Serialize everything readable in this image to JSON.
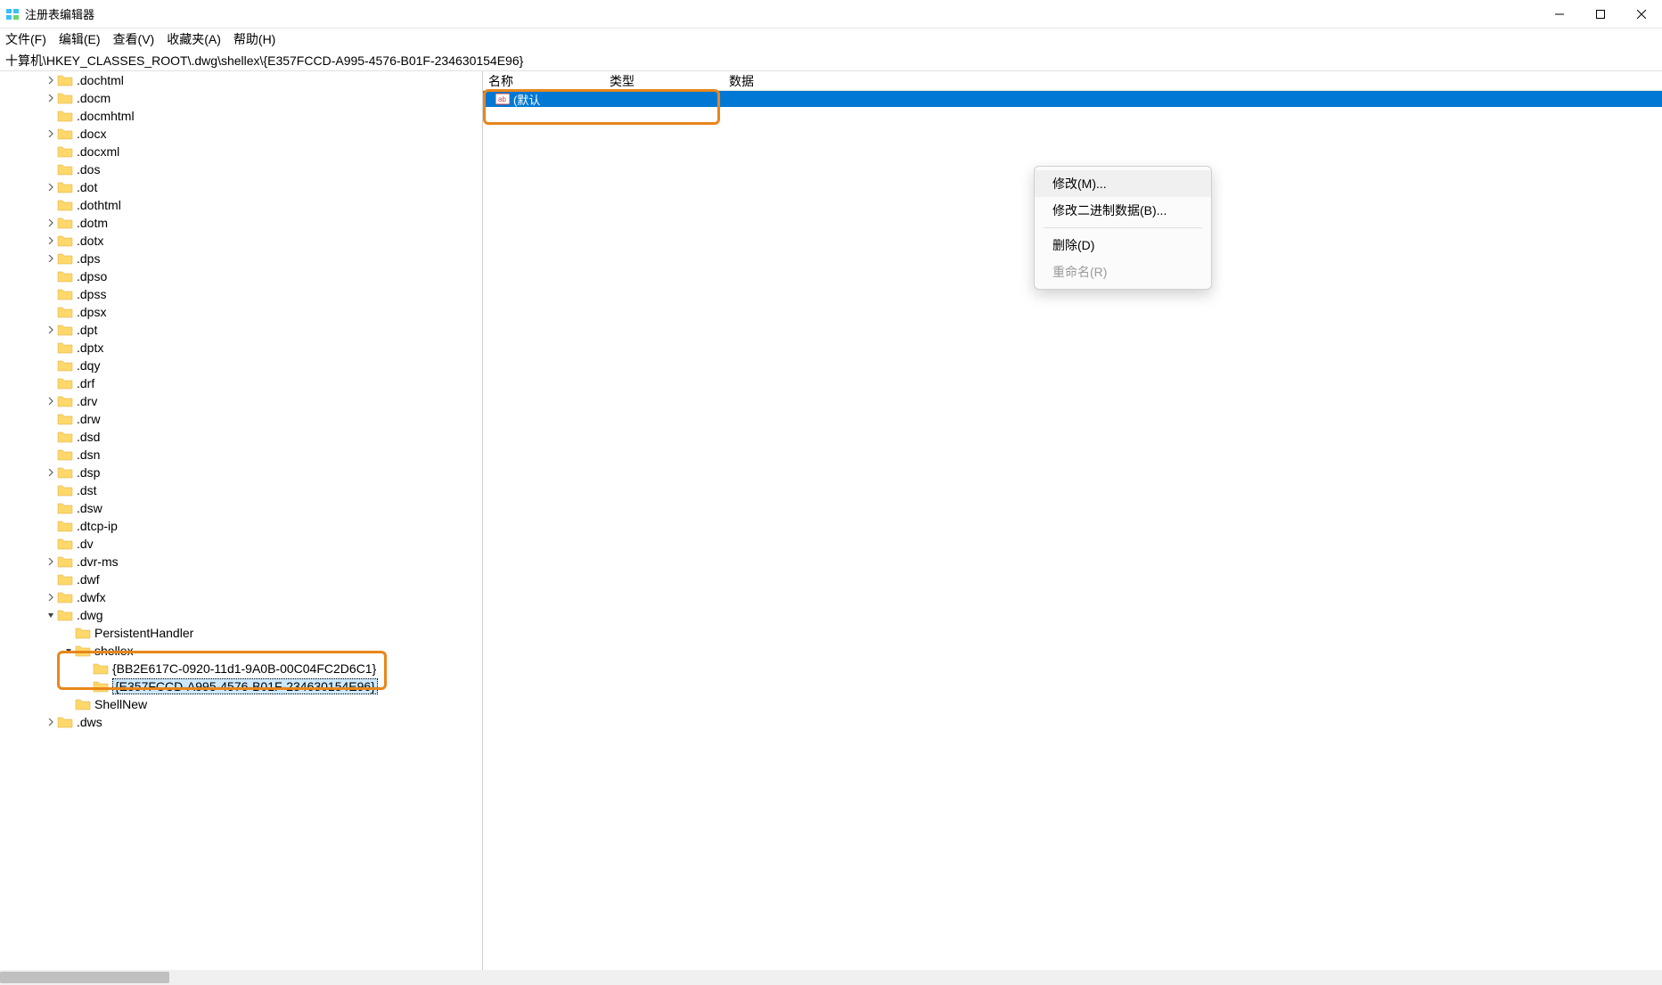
{
  "window": {
    "title": "注册表编辑器"
  },
  "menubar": {
    "file": "文件(F)",
    "edit": "编辑(E)",
    "view": "查看(V)",
    "fav": "收藏夹(A)",
    "help": "帮助(H)"
  },
  "address": "十算机\\HKEY_CLASSES_ROOT\\.dwg\\shellex\\{E357FCCD-A995-4576-B01F-234630154E96}",
  "tree": {
    "items": [
      {
        "label": ".dochtml",
        "indent": 50,
        "expandable": true
      },
      {
        "label": ".docm",
        "indent": 50,
        "expandable": true
      },
      {
        "label": ".docmhtml",
        "indent": 50,
        "expandable": false
      },
      {
        "label": ".docx",
        "indent": 50,
        "expandable": true
      },
      {
        "label": ".docxml",
        "indent": 50,
        "expandable": false
      },
      {
        "label": ".dos",
        "indent": 50,
        "expandable": false
      },
      {
        "label": ".dot",
        "indent": 50,
        "expandable": true
      },
      {
        "label": ".dothtml",
        "indent": 50,
        "expandable": false
      },
      {
        "label": ".dotm",
        "indent": 50,
        "expandable": true
      },
      {
        "label": ".dotx",
        "indent": 50,
        "expandable": true
      },
      {
        "label": ".dps",
        "indent": 50,
        "expandable": true
      },
      {
        "label": ".dpso",
        "indent": 50,
        "expandable": false
      },
      {
        "label": ".dpss",
        "indent": 50,
        "expandable": false
      },
      {
        "label": ".dpsx",
        "indent": 50,
        "expandable": false
      },
      {
        "label": ".dpt",
        "indent": 50,
        "expandable": true
      },
      {
        "label": ".dptx",
        "indent": 50,
        "expandable": false
      },
      {
        "label": ".dqy",
        "indent": 50,
        "expandable": false
      },
      {
        "label": ".drf",
        "indent": 50,
        "expandable": false
      },
      {
        "label": ".drv",
        "indent": 50,
        "expandable": true
      },
      {
        "label": ".drw",
        "indent": 50,
        "expandable": false
      },
      {
        "label": ".dsd",
        "indent": 50,
        "expandable": false
      },
      {
        "label": ".dsn",
        "indent": 50,
        "expandable": false
      },
      {
        "label": ".dsp",
        "indent": 50,
        "expandable": true
      },
      {
        "label": ".dst",
        "indent": 50,
        "expandable": false
      },
      {
        "label": ".dsw",
        "indent": 50,
        "expandable": false
      },
      {
        "label": ".dtcp-ip",
        "indent": 50,
        "expandable": false
      },
      {
        "label": ".dv",
        "indent": 50,
        "expandable": false
      },
      {
        "label": ".dvr-ms",
        "indent": 50,
        "expandable": true
      },
      {
        "label": ".dwf",
        "indent": 50,
        "expandable": false
      },
      {
        "label": ".dwfx",
        "indent": 50,
        "expandable": true
      },
      {
        "label": ".dwg",
        "indent": 50,
        "expandable": true,
        "expanded": true
      },
      {
        "label": "PersistentHandler",
        "indent": 70,
        "expandable": false
      },
      {
        "label": "shellex",
        "indent": 70,
        "expandable": true,
        "expanded": true
      },
      {
        "label": "{BB2E617C-0920-11d1-9A0B-00C04FC2D6C1}",
        "indent": 90,
        "expandable": false
      },
      {
        "label": "{E357FCCD-A995-4576-B01F-234630154E96}",
        "indent": 90,
        "expandable": false,
        "selected": true
      },
      {
        "label": "ShellNew",
        "indent": 70,
        "expandable": false
      },
      {
        "label": ".dws",
        "indent": 50,
        "expandable": true
      }
    ]
  },
  "list": {
    "cols": {
      "name": "名称",
      "type": "类型",
      "data": "数据"
    },
    "row0": {
      "name": "(默认",
      "selected": true
    }
  },
  "context_menu": {
    "modify": "修改(M)...",
    "modify_binary": "修改二进制数据(B)...",
    "delete": "删除(D)",
    "rename": "重命名(R)"
  }
}
